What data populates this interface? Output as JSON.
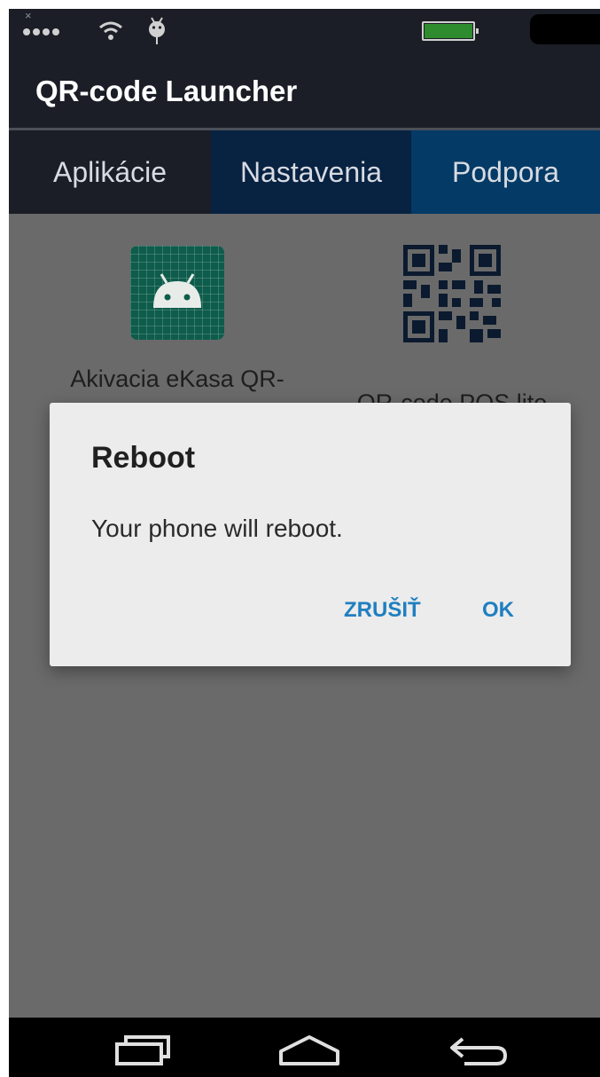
{
  "window": {
    "title": "QR-code Launcher"
  },
  "status_bar": {
    "icons": [
      "close-icon",
      "signal-icon",
      "wifi-icon",
      "debug-icon",
      "battery-icon"
    ],
    "colors": {
      "battery_fill": "#2e8b2e"
    },
    "close_glyph": "×"
  },
  "tabs": [
    {
      "label": "Aplikácie"
    },
    {
      "label": "Nastavenia"
    },
    {
      "label": "Podpora"
    }
  ],
  "apps": [
    {
      "label": "Akivacia eKasa QR-",
      "icon": "android-app-icon"
    },
    {
      "label": "QR-code POS lite",
      "icon": "qr-code-icon"
    }
  ],
  "dialog": {
    "title": "Reboot",
    "message": "Your phone will reboot.",
    "cancel_label": "ZRUŠIŤ",
    "ok_label": "OK",
    "accent_color": "#1f7fc0"
  },
  "nav_bar": {
    "icons": [
      "recent-apps-icon",
      "home-icon",
      "back-icon"
    ]
  }
}
